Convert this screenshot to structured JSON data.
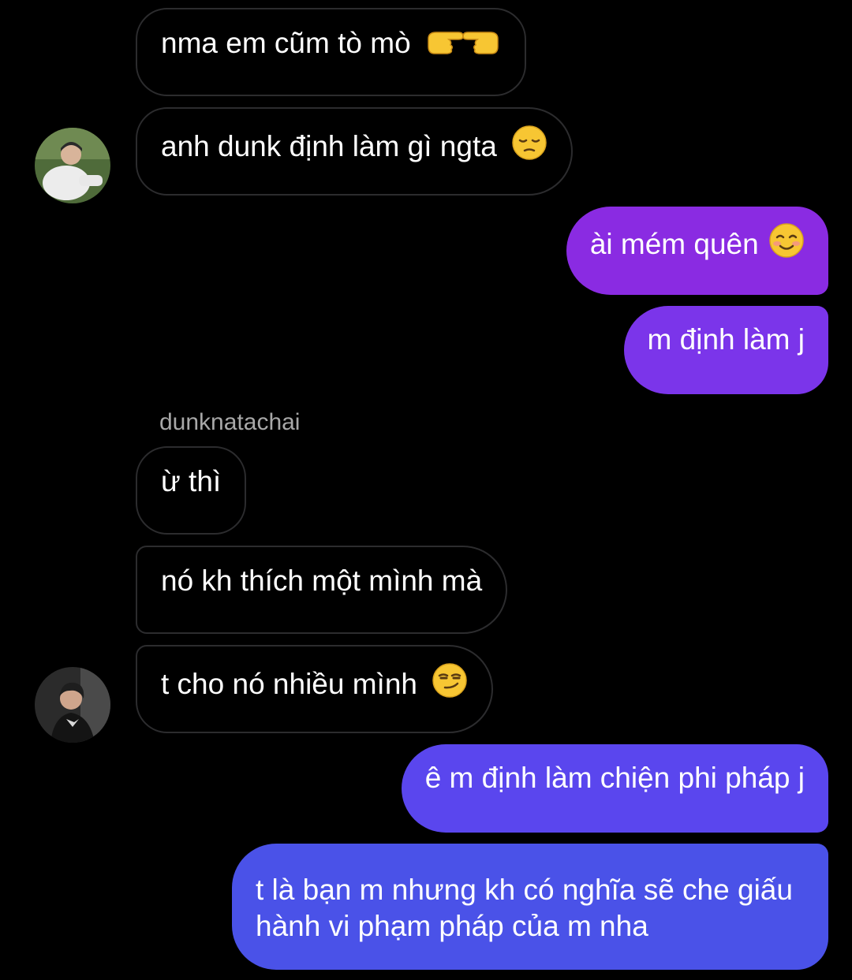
{
  "conversation": {
    "sender_username": "dunknatachai",
    "messages": [
      {
        "direction": "incoming",
        "text": "nma em cũm tò mò",
        "emoji": "pointing-hands-emoji"
      },
      {
        "direction": "incoming",
        "text": "anh dunk định làm gì ngta",
        "emoji": "pensive-face-emoji"
      },
      {
        "direction": "outgoing",
        "text": "ài mém quên",
        "emoji": "smiling-blush-emoji"
      },
      {
        "direction": "outgoing",
        "text": "m định làm j"
      },
      {
        "direction": "incoming",
        "text": "ừ thì"
      },
      {
        "direction": "incoming",
        "text": "nó kh thích một mình mà"
      },
      {
        "direction": "incoming",
        "text": "t cho nó nhiều mình",
        "emoji": "smirking-face-emoji"
      },
      {
        "direction": "outgoing",
        "text": "ê m định làm chiện phi pháp j"
      },
      {
        "direction": "outgoing",
        "text": "t là bạn m nhưng kh có nghĩa sẽ che giấu hành vi phạm pháp của m nha"
      }
    ]
  },
  "colors": {
    "background": "#000000",
    "incoming_border": "#2c2c2e",
    "outgoing_purple": "#8a2be2",
    "outgoing_violet": "#6a3ef0",
    "outgoing_indigo": "#4a52e8",
    "sender_name": "#a8a8a8",
    "emoji_yellow": "#f7c633"
  }
}
